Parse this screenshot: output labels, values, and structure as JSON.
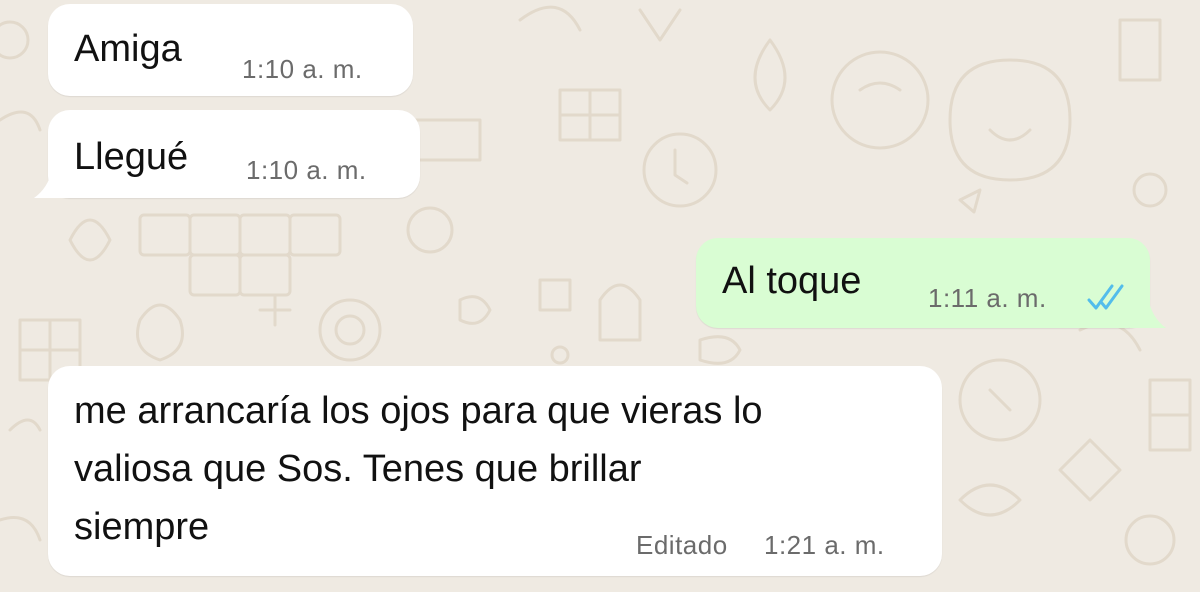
{
  "chat": {
    "messages": [
      {
        "direction": "incoming",
        "lines": [
          "Amiga"
        ],
        "time": "1:10 a. m."
      },
      {
        "direction": "incoming",
        "lines": [
          "Llegué"
        ],
        "time": "1:10 a. m."
      },
      {
        "direction": "outgoing",
        "lines": [
          "Al toque"
        ],
        "time": "1:11 a. m.",
        "status": "read",
        "status_icon": "double-check-icon"
      },
      {
        "direction": "incoming",
        "lines": [
          "me arrancaría los ojos para que vieras lo",
          "valiosa que Sos. Tenes que brillar",
          "siempre"
        ],
        "edited_label": "Editado",
        "time": "1:21 a. m."
      }
    ]
  },
  "colors": {
    "wallpaper": "#efeae2",
    "wallpaper_doodle": "#e4dccf",
    "incoming_bubble": "#ffffff",
    "outgoing_bubble": "#d9fdd3",
    "read_ticks": "#53bdeb",
    "meta_text": "#6b6b6b"
  }
}
